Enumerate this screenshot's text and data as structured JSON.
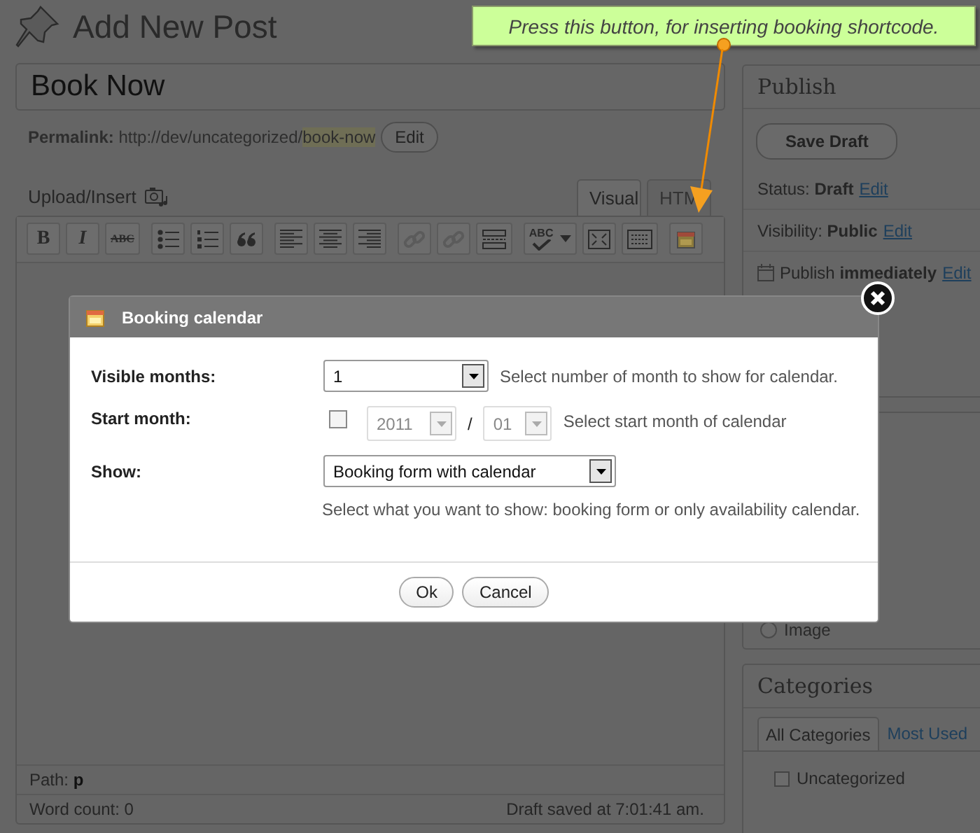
{
  "page_title": "Add New Post",
  "post_title": "Book Now",
  "permalink": {
    "label": "Permalink:",
    "url": "http://dev/uncategorized/",
    "slug": "book-now",
    "button": "Edit"
  },
  "upload_insert": "Upload/Insert",
  "editor_tabs": [
    {
      "label": "Visual",
      "selected": true
    },
    {
      "label": "HTM",
      "selected": false
    }
  ],
  "toolbar": [
    [
      {
        "kind": "bold",
        "label": "B",
        "disabled": false
      },
      {
        "kind": "italic",
        "label": "I",
        "disabled": false
      },
      {
        "kind": "strike",
        "label": "ABC",
        "disabled": false
      }
    ],
    [
      {
        "kind": "ul",
        "disabled": false
      },
      {
        "kind": "ol",
        "disabled": false
      },
      {
        "kind": "quote",
        "disabled": false
      }
    ],
    [
      {
        "kind": "left",
        "disabled": false
      },
      {
        "kind": "center",
        "disabled": false
      },
      {
        "kind": "right",
        "disabled": false
      }
    ],
    [
      {
        "kind": "link",
        "disabled": true
      },
      {
        "kind": "unlink",
        "disabled": true
      },
      {
        "kind": "more",
        "disabled": false
      }
    ],
    [
      {
        "kind": "spell",
        "label": "ABC",
        "disabled": false
      },
      {
        "kind": "fullscreen",
        "disabled": false
      },
      {
        "kind": "kitchen",
        "disabled": false
      }
    ],
    [
      {
        "kind": "booking",
        "disabled": false
      }
    ]
  ],
  "editor_status": {
    "path_label": "Path:",
    "path": "p",
    "word_count": "Word count: 0",
    "draft_saved": "Draft saved at 7:01:41 am."
  },
  "publish": {
    "title": "Publish",
    "save_draft": "Save Draft",
    "rows": [
      {
        "kind": "plain",
        "label": "Status:",
        "value": "Draft",
        "link": "Edit"
      },
      {
        "kind": "plain",
        "label": "Visibility:",
        "value": "Public",
        "link": "Edit"
      },
      {
        "kind": "calendar",
        "label": "Publish",
        "value": "immediately",
        "link": "Edit"
      }
    ]
  },
  "format": {
    "option": "Image",
    "selected": false
  },
  "categories": {
    "title": "Categories",
    "tabs": [
      {
        "label": "All Categories",
        "selected": true
      },
      {
        "label": "Most Used",
        "selected": false
      }
    ],
    "items": [
      {
        "label": "Uncategorized",
        "checked": false
      }
    ]
  },
  "dialog": {
    "title": "Booking calendar",
    "fields": [
      {
        "kind": "select",
        "label": "Visible months:",
        "value": "1",
        "hint": "Select number of month to show for calendar."
      },
      {
        "kind": "month",
        "label": "Start month:",
        "checked": false,
        "year": "2011",
        "separator": "/",
        "month": "01",
        "hint": "Select start month of calendar"
      },
      {
        "kind": "wide_select",
        "label": "Show:",
        "value": "Booking form with calendar",
        "hint": "Select what you want to show: booking form or only availability calendar."
      }
    ],
    "buttons": [
      "Ok",
      "Cancel"
    ]
  },
  "tooltip": "Press this button, for inserting booking shortcode."
}
